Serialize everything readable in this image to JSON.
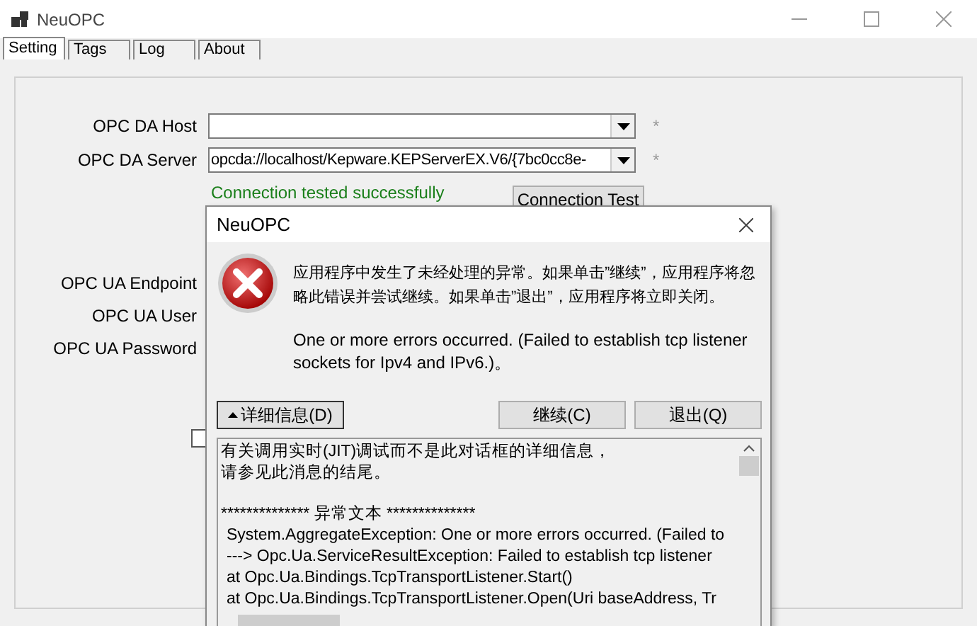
{
  "window": {
    "title": "NeuOPC"
  },
  "tabs": [
    {
      "label": "Setting",
      "selected": true
    },
    {
      "label": "Tags",
      "selected": false
    },
    {
      "label": "Log",
      "selected": false
    },
    {
      "label": "About",
      "selected": false
    }
  ],
  "form": {
    "da_fields": [
      {
        "label": "OPC DA Host",
        "required_mark": "*"
      },
      {
        "label": "OPC DA Server",
        "value": "opcda://localhost/Kepware.KEPServerEX.V6/{7bc0cc8e-",
        "required_mark": "*"
      }
    ],
    "status": "Connection tested successfully",
    "test_button": "Connection Test",
    "ua_fields": [
      {
        "label": "OPC UA Endpoint"
      },
      {
        "label": "OPC UA User"
      },
      {
        "label": "OPC UA Password"
      }
    ],
    "checkbox": {
      "checked": false
    }
  },
  "dialog": {
    "title": "NeuOPC",
    "message": "应用程序中发生了未经处理的异常。如果单击”继续”，应用程序将忽略此错误并尝试继续。如果单击”退出”，应用程序将立即关闭。",
    "error": "One or more errors occurred. (Failed to establish tcp listener sockets for Ipv4 and IPv6.)。",
    "details_button": {
      "label": "详细信息(D)",
      "expanded": true
    },
    "buttons": [
      "继续(C)",
      "退出(Q)"
    ],
    "details": [
      [
        "有关调用实时(JIT)调试而不是此对话框的详细信息，",
        "请参见此消息的结尾。"
      ],
      [
        "************** 异常文本 **************",
        "System.AggregateException: One or more errors occurred. (Failed to",
        "---> Opc.Ua.ServiceResultException: Failed to establish tcp listener",
        "at Opc.Ua.Bindings.TcpTransportListener.Start()",
        "at Opc.Ua.Bindings.TcpTransportListener.Open(Uri baseAddress, Tr"
      ]
    ]
  }
}
